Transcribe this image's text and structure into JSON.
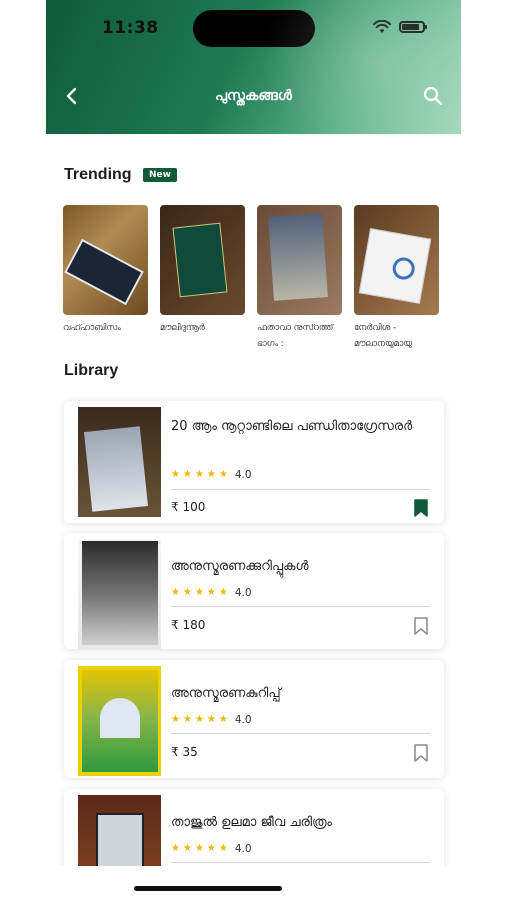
{
  "status_bar": {
    "time": "11:38"
  },
  "header": {
    "title": "പുസ്തകങ്ങൾ"
  },
  "trending": {
    "title": "Trending",
    "badge": "New",
    "items": [
      {
        "label": "വഹ്ഹാബിസം"
      },
      {
        "label": "മൗലിദുന്നൂർ"
      },
      {
        "label": "ഫതാവാ നുസ്റത്ത് ഭാഗം :"
      },
      {
        "label": "നേർവിശ - മൗലാനയുമായു"
      }
    ]
  },
  "library": {
    "title": "Library",
    "books": [
      {
        "title": "20 ആം നൂറ്റാണ്ടിലെ പണ്ഡിതാഗ്രേസരർ",
        "rating": "4.0",
        "price": "₹ 100",
        "bookmarked": true
      },
      {
        "title": "അനുസ്മരണക്കുറിപ്പുകൾ",
        "rating": "4.0",
        "price": "₹ 180",
        "bookmarked": false
      },
      {
        "title": "അനുസ്മരണകുറിപ്പ്",
        "rating": "4.0",
        "price": "₹ 35",
        "bookmarked": false
      },
      {
        "title": "താജുൽ ഉലമാ ജീവ ചരിത്രം",
        "rating": "4.0",
        "price": "",
        "bookmarked": false
      }
    ]
  },
  "colors": {
    "brand_green": "#0e5a3a",
    "star": "#f2b705"
  }
}
